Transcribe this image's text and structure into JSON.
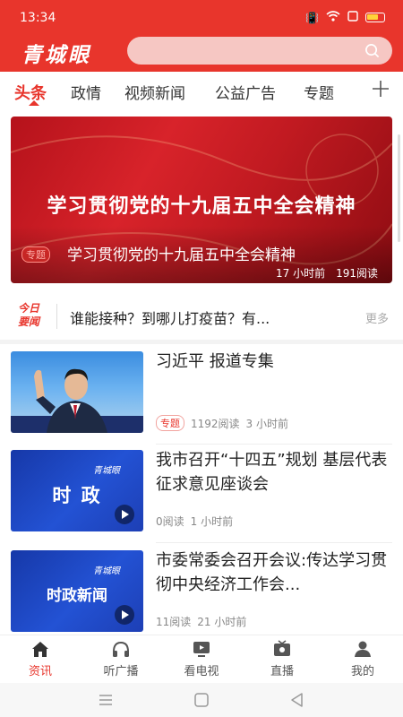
{
  "status": {
    "time": "13:34"
  },
  "app": {
    "logo": "青城眼",
    "accent": "#e8352c"
  },
  "search": {
    "placeholder": ""
  },
  "tabs": [
    {
      "label": "头条",
      "active": true
    },
    {
      "label": "政情"
    },
    {
      "label": "视频新闻"
    },
    {
      "label": "公益广告"
    },
    {
      "label": "专题"
    }
  ],
  "banner": {
    "headline": "学习贯彻党的十九届五中全会精神",
    "tag": "专题",
    "caption": "学习贯彻党的十九届五中全会精神",
    "time": "17 小时前",
    "reads": "191阅读"
  },
  "hot": {
    "badge_line1": "今日",
    "badge_line2": "要闻",
    "text": "谁能接种？到哪儿打疫苗？有...",
    "more": "更多"
  },
  "news": [
    {
      "title": "习近平 报道专集",
      "tag": "专题",
      "reads": "1192阅读",
      "time": "3 小时前",
      "thumb": "photo"
    },
    {
      "title": "我市召开“十四五”规划 基层代表征求意见座谈会",
      "reads": "0阅读",
      "time": "1 小时前",
      "thumb": "video",
      "thumb_logo": "青城眼",
      "thumb_text": "时 政"
    },
    {
      "title": "市委常委会召开会议:传达学习贯彻中央经济工作会...",
      "reads": "11阅读",
      "time": "21 小时前",
      "thumb": "video",
      "thumb_logo": "青城眼",
      "thumb_text": "时政新闻"
    }
  ],
  "nav": [
    {
      "label": "资讯",
      "icon": "home-icon",
      "active": true
    },
    {
      "label": "听广播",
      "icon": "headphones-icon"
    },
    {
      "label": "看电视",
      "icon": "tv-icon"
    },
    {
      "label": "直播",
      "icon": "live-icon"
    },
    {
      "label": "我的",
      "icon": "user-icon"
    }
  ]
}
